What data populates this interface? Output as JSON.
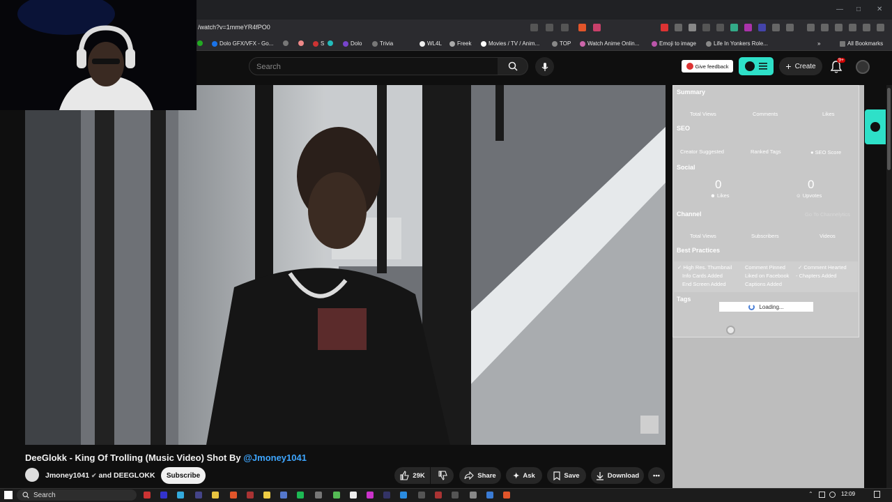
{
  "browser": {
    "url": "/watch?v=1mmeYR4fPO0",
    "bookmarks": [
      "Dolo GFX/VFX - Go...",
      "S",
      "Dolo",
      "Trivia",
      "WL4L",
      "Freek",
      "Movies / TV / Anim...",
      "TOP",
      "Watch Anime Onlin...",
      "Emoji to image",
      "Life In Yonkers Role..."
    ],
    "all_bookmarks": "All Bookmarks"
  },
  "header": {
    "search_placeholder": "Search",
    "give_feedback": "Give feedback",
    "create": "Create",
    "notif_badge": "9+"
  },
  "video": {
    "title_main": "DeeGlokk - King Of Trolling (Music Video) Shot By ",
    "title_link": "@Jmoney1041",
    "channel": "Jmoney1041",
    "channel_and": "and DEEGLOKK",
    "subscribe": "Subscribe",
    "like_count": "29K",
    "share": "Share",
    "ask": "Ask",
    "save": "Save",
    "download": "Download"
  },
  "panel": {
    "summary": "Summary",
    "summary_labels": [
      "Total Views",
      "Comments",
      "Likes"
    ],
    "seo": "SEO",
    "seo_labels": [
      "Creator Suggested",
      "Ranked Tags",
      "SEO Score"
    ],
    "social": "Social",
    "social_likes_val": "0",
    "social_likes": "Likes",
    "social_upvotes_val": "0",
    "social_upvotes": "Upvotes",
    "channel": "Channel",
    "channel_link": "Go To Channelytics",
    "channel_labels": [
      "Total Views",
      "Subscribers",
      "Videos"
    ],
    "best_practices": "Best Practices",
    "bp_items": [
      "High Res. Thumbnail",
      "Info Cards Added",
      "End Screen Added",
      "Comment Pinned",
      "Liked on Facebook",
      "Captions Added",
      "Comment Hearted",
      "Chapters Added"
    ],
    "tags": "Tags",
    "loading": "Loading..."
  },
  "taskbar": {
    "search": "Search",
    "time": "12:09"
  },
  "colors": {
    "accent": "#2ee0c8",
    "link": "#3ea6ff"
  }
}
